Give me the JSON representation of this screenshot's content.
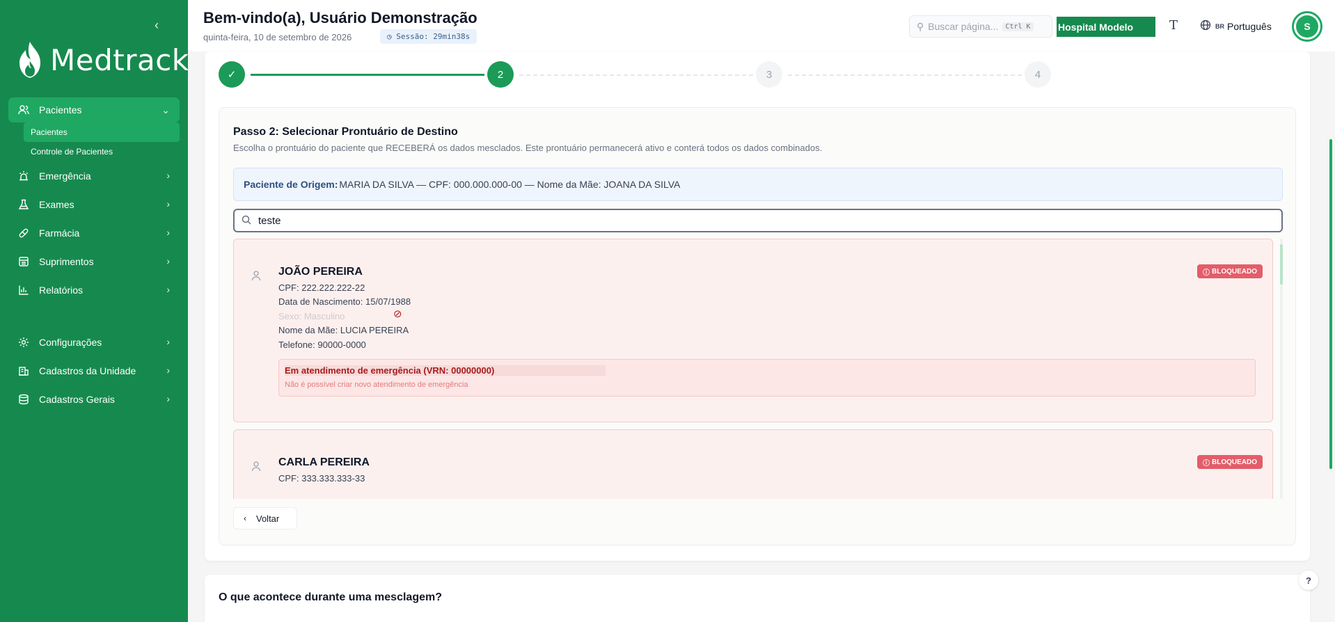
{
  "sidebar": {
    "logo_text": "Medtrack",
    "collapse_icon": "chevron-left-icon",
    "items": [
      {
        "label": "Pacientes",
        "icon": "users-icon",
        "expanded": true,
        "children": [
          {
            "label": "Pacientes",
            "active": true
          },
          {
            "label": "Controle de Pacientes",
            "active": false
          }
        ]
      },
      {
        "label": "Emergência",
        "icon": "siren-icon"
      },
      {
        "label": "Exames",
        "icon": "flask-icon"
      },
      {
        "label": "Farmácia",
        "icon": "pill-icon"
      },
      {
        "label": "Suprimentos",
        "icon": "box-icon"
      },
      {
        "label": "Relatórios",
        "icon": "chart-icon"
      },
      {
        "label": "Configurações",
        "icon": "gear-icon"
      },
      {
        "label": "Cadastros da Unidade",
        "icon": "building-icon"
      },
      {
        "label": "Cadastros Gerais",
        "icon": "database-icon"
      }
    ]
  },
  "header": {
    "welcome": "Bem-vindo(a), Usuário Demonstração",
    "date": "quinta-feira, 10 de setembro de 2026",
    "session": "Sessão: 29min38s",
    "search_placeholder": "Buscar página...",
    "search_shortcut": "Ctrl K",
    "hospital": "Hospital Modelo",
    "language_flag": "BR",
    "language": "Português",
    "avatar_initial": "S"
  },
  "stepper": {
    "steps": [
      {
        "label": "✓",
        "state": "done"
      },
      {
        "label": "2",
        "state": "current"
      },
      {
        "label": "3",
        "state": "pending"
      },
      {
        "label": "4",
        "state": "pending"
      }
    ]
  },
  "step2": {
    "title": "Passo 2: Selecionar Prontuário de Destino",
    "description": "Escolha o prontuário do paciente que RECEBERÁ os dados mesclados. Este prontuário permanecerá ativo e conterá todos os dados combinados.",
    "origin_label": "Paciente de Origem:",
    "origin_value": "MARIA DA SILVA — CPF: 000.000.000-00 — Nome da Mãe: JOANA DA SILVA",
    "search_value": "teste",
    "results": [
      {
        "name": "JOÃO PEREIRA",
        "badge": "BLOQUEADO",
        "cpf": "CPF: 222.222.222-22",
        "birth": "Data de Nascimento: 15/07/1988",
        "sex": "Sexo: Masculino",
        "mother": "Nome da Mãe: LUCIA PEREIRA",
        "phone": "Telefone: 90000-0000",
        "alert_title": "Em atendimento de emergência (VRN: 00000000)",
        "alert_sub": "Não é possível criar novo atendimento de emergência"
      },
      {
        "name": "CARLA PEREIRA",
        "badge": "BLOQUEADO",
        "cpf": "CPF: 333.333.333-33"
      }
    ],
    "back_label": "Voltar"
  },
  "info": {
    "question": "O que acontece durante uma mesclagem?"
  },
  "colors": {
    "brand": "#168a4e",
    "accent": "#1fa862",
    "blocked": "#e35d6a"
  }
}
